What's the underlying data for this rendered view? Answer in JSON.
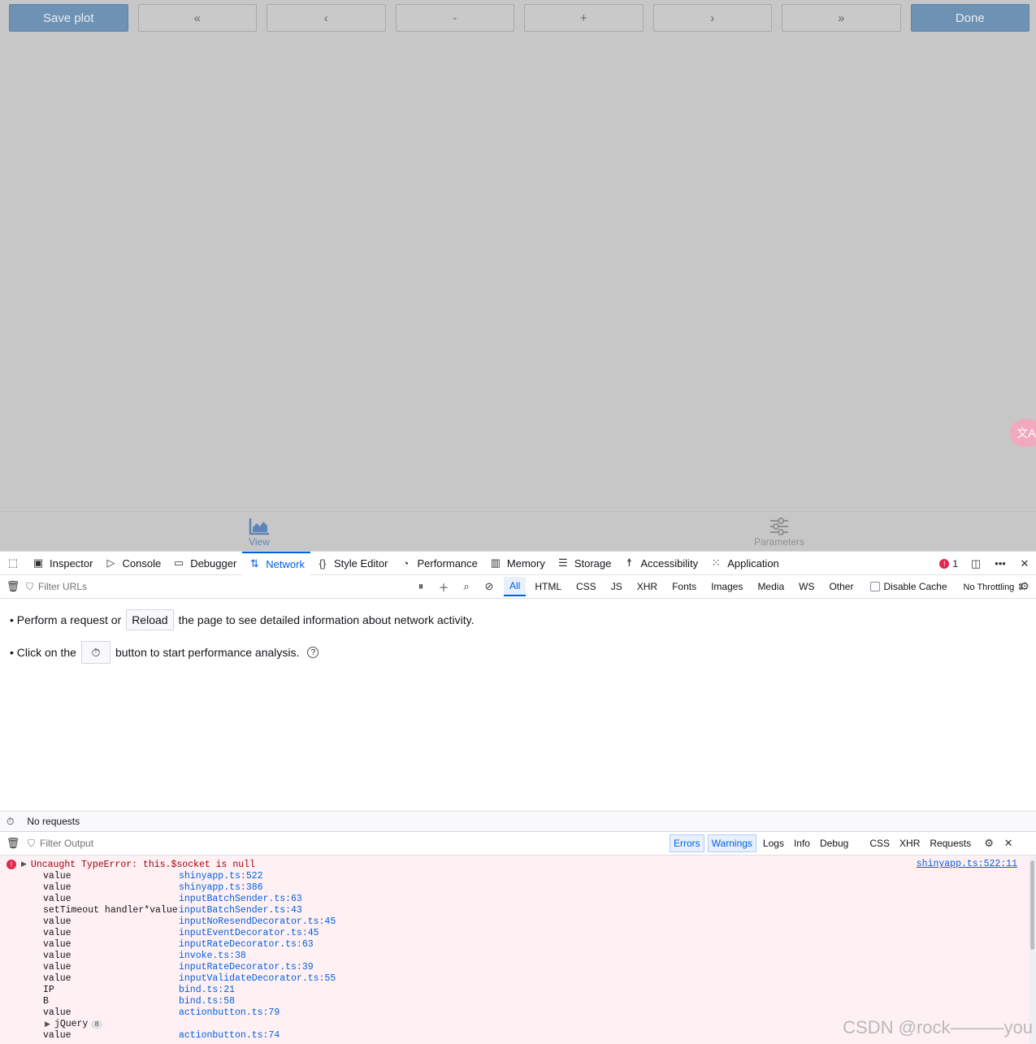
{
  "toolbar": {
    "save": "Save plot",
    "first": "«",
    "prev": "‹",
    "minus": "-",
    "plus": "+",
    "next": "›",
    "last": "»",
    "done": "Done"
  },
  "translate": "文A",
  "bottomnav": {
    "view": "View",
    "parameters": "Parameters"
  },
  "devtools": {
    "tabs": [
      "Inspector",
      "Console",
      "Debugger",
      "Network",
      "Style Editor",
      "Performance",
      "Memory",
      "Storage",
      "Accessibility",
      "Application"
    ],
    "error_count": "1",
    "filter_urls": "Filter URLs",
    "chips": [
      "All",
      "HTML",
      "CSS",
      "JS",
      "XHR",
      "Fonts",
      "Images",
      "Media",
      "WS",
      "Other"
    ],
    "disable_cache": "Disable Cache",
    "throttle": "No Throttling ⇕",
    "empty": {
      "line1a": "• Perform a request or",
      "reload": "Reload",
      "line1b": "the page to see detailed information about network activity.",
      "line2a": "• Click on the",
      "line2b": "button to start performance analysis."
    },
    "status": "No requests",
    "console": {
      "filter": "Filter Output",
      "levels": [
        "Errors",
        "Warnings",
        "Logs",
        "Info",
        "Debug"
      ],
      "others": [
        "CSS",
        "XHR",
        "Requests"
      ],
      "error": "Uncaught TypeError: this.$socket is null",
      "error_src": "shinyapp.ts:522:11",
      "frames": [
        {
          "fn": "value",
          "loc": "shinyapp.ts:522"
        },
        {
          "fn": "value",
          "loc": "shinyapp.ts:386"
        },
        {
          "fn": "value",
          "loc": "inputBatchSender.ts:63"
        },
        {
          "fn": "setTimeout handler*value",
          "loc": "inputBatchSender.ts:43"
        },
        {
          "fn": "value",
          "loc": "inputNoResendDecorator.ts:45"
        },
        {
          "fn": "value",
          "loc": "inputEventDecorator.ts:45"
        },
        {
          "fn": "value",
          "loc": "inputRateDecorator.ts:63"
        },
        {
          "fn": "value",
          "loc": "invoke.ts:38"
        },
        {
          "fn": "value",
          "loc": "inputRateDecorator.ts:39"
        },
        {
          "fn": "value",
          "loc": "inputValidateDecorator.ts:55"
        },
        {
          "fn": "IP",
          "loc": "bind.ts:21"
        },
        {
          "fn": "B",
          "loc": "bind.ts:58"
        },
        {
          "fn": "value",
          "loc": "actionbutton.ts:79"
        }
      ],
      "jquery": "jQuery",
      "jquery_count": "8",
      "last_frame": {
        "fn": "value",
        "loc": "actionbutton.ts:74"
      }
    }
  },
  "watermark": "CSDN @rock———you"
}
